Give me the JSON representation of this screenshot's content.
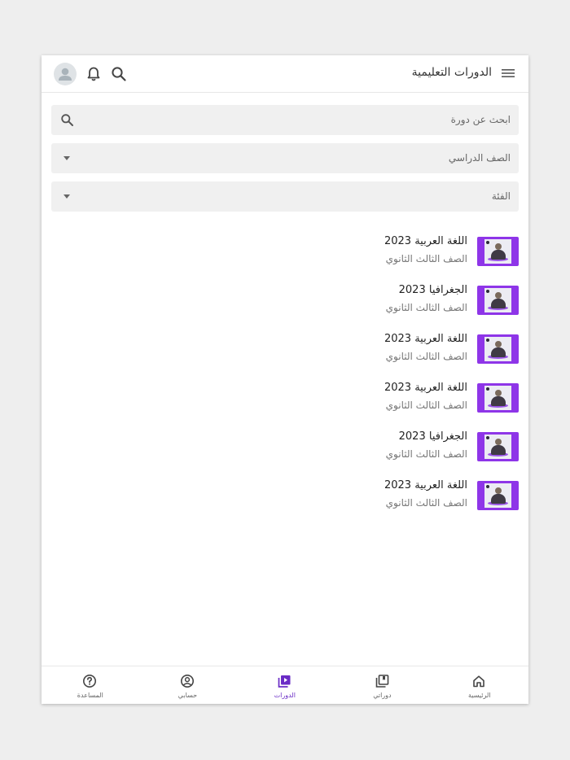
{
  "header": {
    "title": "الدورات التعليمية"
  },
  "filters": {
    "search_placeholder": "ابحث عن دورة",
    "grade_label": "الصف الدراسي",
    "category_label": "الفئة"
  },
  "courses": [
    {
      "title": "اللغة العربية 2023",
      "grade": "الصف الثالث الثانوي"
    },
    {
      "title": "الجغرافيا 2023",
      "grade": "الصف الثالث الثانوي"
    },
    {
      "title": "اللغة العربية 2023",
      "grade": "الصف الثالث الثانوي"
    },
    {
      "title": "اللغة العربية 2023",
      "grade": "الصف الثالث الثانوي"
    },
    {
      "title": "الجغرافيا 2023",
      "grade": "الصف الثالث الثانوي"
    },
    {
      "title": "اللغة العربية 2023",
      "grade": "الصف الثالث الثانوي"
    }
  ],
  "bottom_nav": {
    "items": [
      {
        "label": "الرئيسية",
        "icon": "home-icon"
      },
      {
        "label": "دوراتي",
        "icon": "library-icon"
      },
      {
        "label": "الدورات",
        "icon": "video-library-icon",
        "active": true
      },
      {
        "label": "حسابي",
        "icon": "account-circle-icon"
      },
      {
        "label": "المساعدة",
        "icon": "help-icon"
      }
    ]
  },
  "colors": {
    "accent": "#6a2cc6",
    "thumbnail": "#8e35e8",
    "field_bg": "#f0f0f0"
  }
}
